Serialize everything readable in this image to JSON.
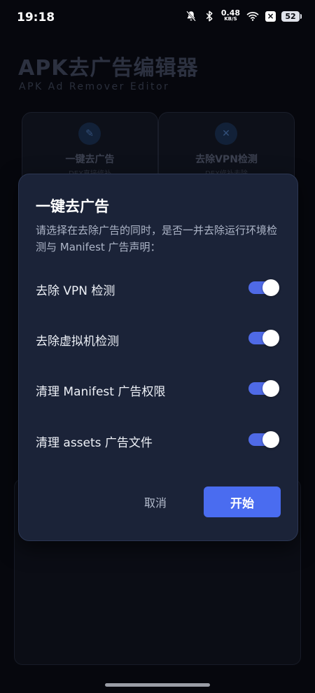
{
  "status_bar": {
    "time": "19:18",
    "net_speed_value": "0.48",
    "net_speed_unit": "KB/S",
    "x_badge": "×",
    "battery": "52",
    "icons": [
      "mute-bell-icon",
      "bluetooth-icon",
      "wifi-icon"
    ]
  },
  "app": {
    "title": "APK去广告编辑器",
    "subtitle": "APK Ad Remover Editor",
    "features": [
      {
        "label": "一键去广告",
        "sub": "DEX直接修补",
        "icon": "syringe-icon",
        "icon_glyph": "✎"
      },
      {
        "label": "去除VPN检测",
        "sub": "DEX修补去除",
        "icon": "cross-icon",
        "icon_glyph": "✕"
      }
    ]
  },
  "dialog": {
    "title": "一键去广告",
    "description": "请选择在去除广告的同时，是否一并去除运行环境检测与 Manifest 广告声明：",
    "options": [
      {
        "label": "去除 VPN 检测",
        "enabled": true
      },
      {
        "label": "去除虚拟机检测",
        "enabled": true
      },
      {
        "label": "清理 Manifest 广告权限",
        "enabled": true
      },
      {
        "label": "清理 assets 广告文件",
        "enabled": true
      }
    ],
    "cancel_label": "取消",
    "start_label": "开始"
  },
  "colors": {
    "accent": "#4a6cf0",
    "dialog_bg": "#1b2338",
    "background": "#06070d"
  }
}
